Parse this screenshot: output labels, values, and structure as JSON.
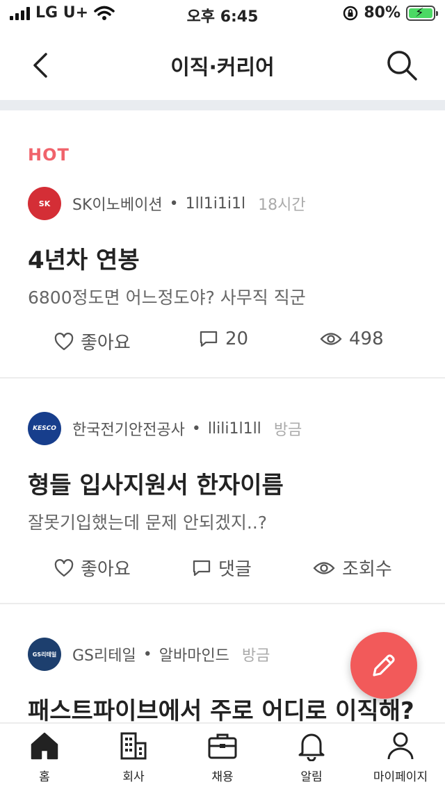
{
  "status_bar": {
    "carrier": "LG U+",
    "time": "오후 6:45",
    "battery": "80%"
  },
  "header": {
    "title": "이직·커리어"
  },
  "posts": [
    {
      "badge": "HOT",
      "avatar_color": "#d42e36",
      "avatar_text": "SK",
      "company": "SK이노베이션",
      "nickname": "1ll1i1i1l",
      "time": "18시간",
      "title": "4년차 연봉",
      "body": "6800정도면 어느정도야? 사무직 직군",
      "like_label": "좋아요",
      "comment_label": "20",
      "view_label": "498"
    },
    {
      "badge": "",
      "avatar_color": "#173e8c",
      "avatar_text": "KESCO",
      "company": "한국전기안전공사",
      "nickname": "llili1l1ll",
      "time": "방금",
      "title": "형들 입사지원서 한자이름",
      "body": "잘못기입했는데 문제 안되겠지..?",
      "like_label": "좋아요",
      "comment_label": "댓글",
      "view_label": "조회수"
    },
    {
      "badge": "",
      "avatar_color": "#1d3f6e",
      "avatar_text": "GS리테일",
      "company": "GS리테일",
      "nickname": "알바마인드",
      "time": "방금",
      "title": "패스트파이브에서 주로 어디로 이직해?",
      "body": "",
      "like_label": "",
      "comment_label": "",
      "view_label": ""
    }
  ],
  "tabs": [
    {
      "label": "홈",
      "icon": "home-icon"
    },
    {
      "label": "회사",
      "icon": "building-icon"
    },
    {
      "label": "채용",
      "icon": "briefcase-icon"
    },
    {
      "label": "알림",
      "icon": "bell-icon"
    },
    {
      "label": "마이페이지",
      "icon": "person-icon"
    }
  ],
  "colors": {
    "accent": "#f25a5a",
    "hot": "#f0636b"
  }
}
